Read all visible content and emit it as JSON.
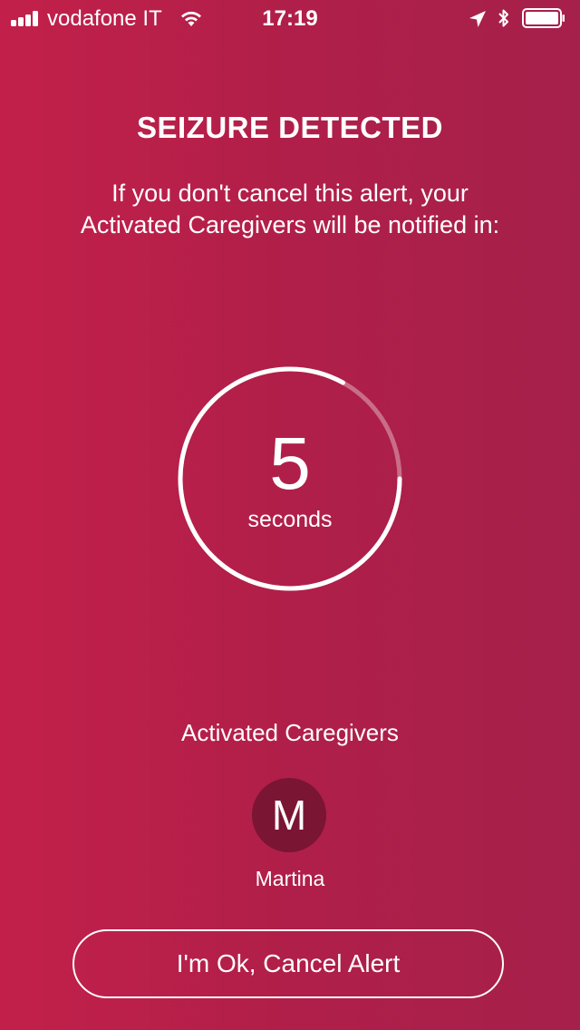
{
  "status_bar": {
    "carrier": "vodafone IT",
    "time": "17:19",
    "icons": [
      "signal-icon",
      "wifi-icon",
      "location-arrow-icon",
      "bluetooth-icon",
      "battery-icon"
    ]
  },
  "alert": {
    "title": "SEIZURE DETECTED",
    "message": "If you don't cancel this alert, your Activated Caregivers will be notified in:"
  },
  "countdown": {
    "value": "5",
    "unit": "seconds",
    "remaining_fraction": 0.83
  },
  "caregivers": {
    "heading": "Activated Caregivers",
    "items": [
      {
        "initial": "M",
        "name": "Martina"
      }
    ]
  },
  "actions": {
    "cancel_label": "I'm Ok, Cancel Alert"
  },
  "colors": {
    "background_start": "#c2204a",
    "background_end": "#a5204b",
    "avatar": "#7a1533",
    "text": "#ffffff"
  }
}
